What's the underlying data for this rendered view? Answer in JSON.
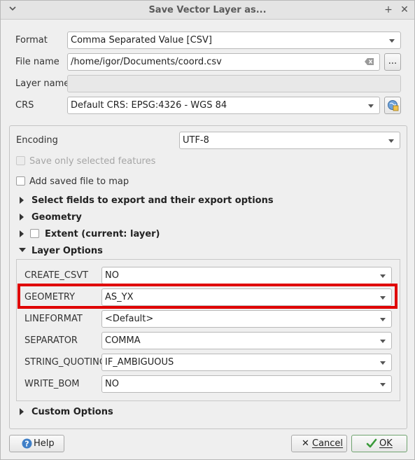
{
  "window": {
    "title": "Save Vector Layer as..."
  },
  "form": {
    "format_label": "Format",
    "format_value": "Comma Separated Value [CSV]",
    "filename_label": "File name",
    "filename_value": "/home/igor/Documents/coord.csv",
    "browse_label": "...",
    "layername_label": "Layer name",
    "crs_label": "CRS",
    "crs_value": "Default CRS: EPSG:4326 - WGS 84"
  },
  "options": {
    "encoding_label": "Encoding",
    "encoding_value": "UTF-8",
    "save_selected_label": "Save only selected features",
    "add_to_map_label": "Add saved file to map",
    "sections": {
      "fields": "Select fields to export and their export options",
      "geometry": "Geometry",
      "extent": "Extent (current: layer)",
      "layer_options": "Layer Options",
      "custom_options": "Custom Options"
    }
  },
  "layer_options": [
    {
      "key": "CREATE_CSVT",
      "value": "NO"
    },
    {
      "key": "GEOMETRY",
      "value": "AS_YX"
    },
    {
      "key": "LINEFORMAT",
      "value": "<Default>"
    },
    {
      "key": "SEPARATOR",
      "value": "COMMA"
    },
    {
      "key": "STRING_QUOTING",
      "value": "IF_AMBIGUOUS"
    },
    {
      "key": "WRITE_BOM",
      "value": "NO"
    }
  ],
  "buttons": {
    "help": "Help",
    "cancel": "Cancel",
    "ok": "OK"
  },
  "colors": {
    "highlight": "#e00000",
    "accent_ok": "#3a9a3a"
  }
}
